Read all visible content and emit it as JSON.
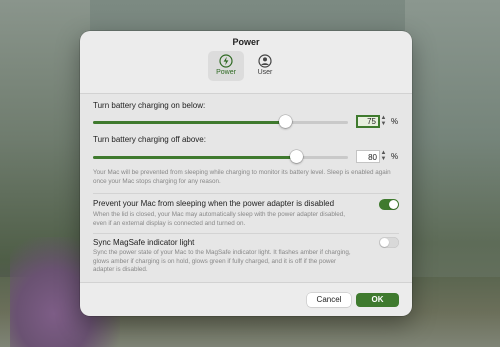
{
  "window": {
    "title": "Power"
  },
  "tabs": [
    {
      "label": "Power",
      "icon": "lightning-bolt-icon",
      "selected": true
    },
    {
      "label": "User",
      "icon": "user-circle-icon",
      "selected": false
    }
  ],
  "charge_on": {
    "label": "Turn battery charging on below:",
    "value": "75",
    "unit": "%",
    "level_percent": 75
  },
  "charge_off": {
    "label": "Turn battery charging off above:",
    "value": "80",
    "unit": "%",
    "level_percent": 80
  },
  "sleep_note": "Your Mac will be prevented from sleeping while charging to monitor its battery level. Sleep is enabled again once your Mac stops charging for any reason.",
  "prevent_sleep": {
    "title": "Prevent your Mac from sleeping when the power adapter is disabled",
    "description": "When the lid is closed, your Mac may automatically sleep with the power adapter disabled, even if an external display is connected and turned on.",
    "enabled": true
  },
  "magsafe": {
    "title": "Sync MagSafe indicator light",
    "description": "Sync the power state of your Mac to the MagSafe indicator light. It flashes amber if charging, glows amber if charging is on hold, glows green if fully charged, and it is off if the power adapter is disabled.",
    "enabled": false
  },
  "buttons": {
    "cancel": "Cancel",
    "ok": "OK"
  },
  "colors": {
    "accent": "#3f7a2e"
  }
}
